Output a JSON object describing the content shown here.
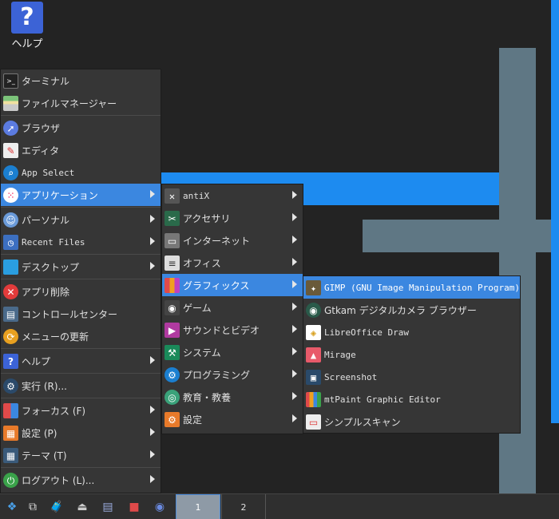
{
  "desktop": {
    "help_label": "ヘルプ",
    "help_glyph": "?"
  },
  "menu_main": {
    "items": [
      {
        "label": "ターミナル",
        "icon": "terminal-icon"
      },
      {
        "label": "ファイルマネージャー",
        "icon": "file-manager-icon"
      },
      {
        "label": "ブラウザ",
        "icon": "browser-icon"
      },
      {
        "label": "エディタ",
        "icon": "editor-icon"
      },
      {
        "label": "App Select",
        "icon": "app-select-icon"
      },
      {
        "label": "アプリケーション",
        "icon": "applications-icon"
      },
      {
        "label": "パーソナル",
        "icon": "personal-icon"
      },
      {
        "label": "Recent Files",
        "icon": "recent-files-icon"
      },
      {
        "label": "デスクトップ",
        "icon": "desktop-icon"
      },
      {
        "label": "アプリ削除",
        "icon": "remove-app-icon"
      },
      {
        "label": "コントロールセンター",
        "icon": "control-center-icon"
      },
      {
        "label": "メニューの更新",
        "icon": "menu-refresh-icon"
      },
      {
        "label": "ヘルプ",
        "icon": "help-icon"
      },
      {
        "label": "実行 (R)...",
        "icon": "run-icon"
      },
      {
        "label": "フォーカス (F)",
        "icon": "focus-icon"
      },
      {
        "label": "設定 (P)",
        "icon": "preferences-icon"
      },
      {
        "label": "テーマ (T)",
        "icon": "theme-icon"
      },
      {
        "label": "ログアウト (L)...",
        "icon": "logout-icon"
      }
    ]
  },
  "menu_apps": {
    "items": [
      {
        "label": "antiX",
        "icon": "antix-icon"
      },
      {
        "label": "アクセサリ",
        "icon": "accessories-icon"
      },
      {
        "label": "インターネット",
        "icon": "internet-icon"
      },
      {
        "label": "オフィス",
        "icon": "office-icon"
      },
      {
        "label": "グラフィックス",
        "icon": "graphics-icon"
      },
      {
        "label": "ゲーム",
        "icon": "games-icon"
      },
      {
        "label": "サウンドとビデオ",
        "icon": "sound-video-icon"
      },
      {
        "label": "システム",
        "icon": "system-icon"
      },
      {
        "label": "プログラミング",
        "icon": "programming-icon"
      },
      {
        "label": "教育・教養",
        "icon": "education-icon"
      },
      {
        "label": "設定",
        "icon": "settings-icon"
      }
    ]
  },
  "menu_graphics": {
    "items": [
      {
        "label": "GIMP (GNU Image Manipulation Program)",
        "icon": "gimp-icon"
      },
      {
        "label": "Gtkam デジタルカメラ ブラウザー",
        "icon": "gtkam-icon"
      },
      {
        "label": "LibreOffice Draw",
        "icon": "libreoffice-draw-icon"
      },
      {
        "label": "Mirage",
        "icon": "mirage-icon"
      },
      {
        "label": "Screenshot",
        "icon": "screenshot-icon"
      },
      {
        "label": "mtPaint Graphic Editor",
        "icon": "mtpaint-icon"
      },
      {
        "label": "シンプルスキャン",
        "icon": "simple-scan-icon"
      }
    ]
  },
  "taskbar": {
    "icons": [
      "start-menu-icon",
      "windows-icon",
      "package-icon",
      "eject-icon",
      "files-icon",
      "folder-icon",
      "browser-icon"
    ],
    "pagers": [
      "1",
      "2"
    ],
    "active_pager": "1"
  },
  "colors": {
    "accent": "#3b87e0",
    "wall_steel": "#5f7784",
    "wall_blue": "#1d8bf0"
  }
}
